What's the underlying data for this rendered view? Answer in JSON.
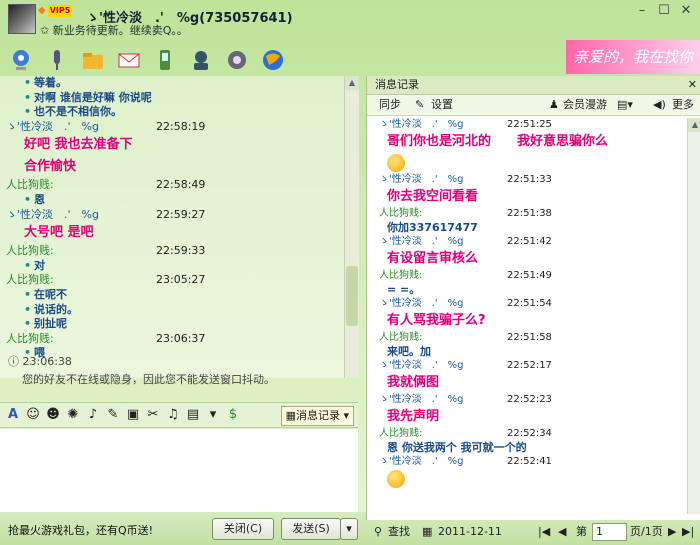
{
  "window": {
    "vip_badge": "VIP5",
    "title": "ゝ'性冷淡　.'　%g(735057641)",
    "subtitle": "新业务待更新。继续卖Q。。",
    "banner_text": "亲爱的，我在找你"
  },
  "chat": {
    "lines": [
      {
        "kind": "msg",
        "text": "等着。"
      },
      {
        "kind": "msg",
        "text": "对啊 谁信是好嘛 你说呢"
      },
      {
        "kind": "msg",
        "text": "也不是不相信你。"
      },
      {
        "kind": "header",
        "name": "ゝ'性冷淡　.'　%g",
        "time": "22:58:19"
      },
      {
        "kind": "big",
        "text": "好吧  我也去准备下"
      },
      {
        "kind": "big",
        "text": "合作愉快"
      },
      {
        "kind": "header",
        "name": "人比狗贱:",
        "time": "22:58:49"
      },
      {
        "kind": "msg",
        "text": "恩"
      },
      {
        "kind": "header",
        "name": "ゝ'性冷淡　.'　%g",
        "time": "22:59:27"
      },
      {
        "kind": "big",
        "text": "大号吧  是吧"
      },
      {
        "kind": "header",
        "name": "人比狗贱:",
        "time": "22:59:33"
      },
      {
        "kind": "msg",
        "text": "对"
      },
      {
        "kind": "header",
        "name": "人比狗贱:",
        "time": "23:05:27"
      },
      {
        "kind": "msg",
        "text": "在呢不"
      },
      {
        "kind": "msg",
        "text": "说话的。"
      },
      {
        "kind": "msg",
        "text": "别扯呢"
      },
      {
        "kind": "header",
        "name": "人比狗贱:",
        "time": "23:06:37"
      },
      {
        "kind": "msg",
        "text": "喂"
      }
    ],
    "sys_time": "23:06:38",
    "sys_text": "您的好友不在线或隐身，因此您不能发送窗口抖动。"
  },
  "toolbar": {
    "history_button": "消息记录"
  },
  "bottom": {
    "ad_text": "抢最火游戏礼包，还有Q币送!",
    "close_label": "关闭(C)",
    "send_label": "发送(S)"
  },
  "history": {
    "title": "消息记录",
    "sync_label": "同步",
    "settings_label": "设置",
    "member_label": "会员漫游",
    "more_label": "更多",
    "entries": [
      {
        "kind": "header",
        "name": "ゝ'性冷淡　.'　%g",
        "time": "22:51:25"
      },
      {
        "kind": "big",
        "text": "哥们你也是河北的　　我好意思骗你么"
      },
      {
        "kind": "emoji"
      },
      {
        "kind": "header",
        "name": "ゝ'性冷淡　.'　%g",
        "time": "22:51:33"
      },
      {
        "kind": "big",
        "text": "你去我空间看看"
      },
      {
        "kind": "header2",
        "name": "人比狗贱:",
        "time": "22:51:38"
      },
      {
        "kind": "small",
        "text": "你加337617477"
      },
      {
        "kind": "header",
        "name": "ゝ'性冷淡　.'　%g",
        "time": "22:51:42"
      },
      {
        "kind": "big",
        "text": "有设留言审核么"
      },
      {
        "kind": "header2",
        "name": "人比狗贱:",
        "time": "22:51:49"
      },
      {
        "kind": "small",
        "text": "= =。"
      },
      {
        "kind": "header",
        "name": "ゝ'性冷淡　.'　%g",
        "time": "22:51:54"
      },
      {
        "kind": "big",
        "text": "有人骂我骗子么?"
      },
      {
        "kind": "header2",
        "name": "人比狗贱:",
        "time": "22:51:58"
      },
      {
        "kind": "small",
        "text": "来吧。加"
      },
      {
        "kind": "header",
        "name": "ゝ'性冷淡　.'　%g",
        "time": "22:52:17"
      },
      {
        "kind": "big",
        "text": "我就俩图"
      },
      {
        "kind": "header",
        "name": "ゝ'性冷淡　.'　%g",
        "time": "22:52:23"
      },
      {
        "kind": "big",
        "text": "我先声明"
      },
      {
        "kind": "header2",
        "name": "人比狗贱:",
        "time": "22:52:34"
      },
      {
        "kind": "small",
        "text": "恩 你送我两个 我可就一个的"
      },
      {
        "kind": "header",
        "name": "ゝ'性冷淡　.'　%g",
        "time": "22:52:41"
      },
      {
        "kind": "emoji"
      }
    ],
    "search_label": "查找",
    "date": "2011-12-11",
    "page_prefix": "第",
    "page_value": "1",
    "page_suffix": "页/1页"
  }
}
